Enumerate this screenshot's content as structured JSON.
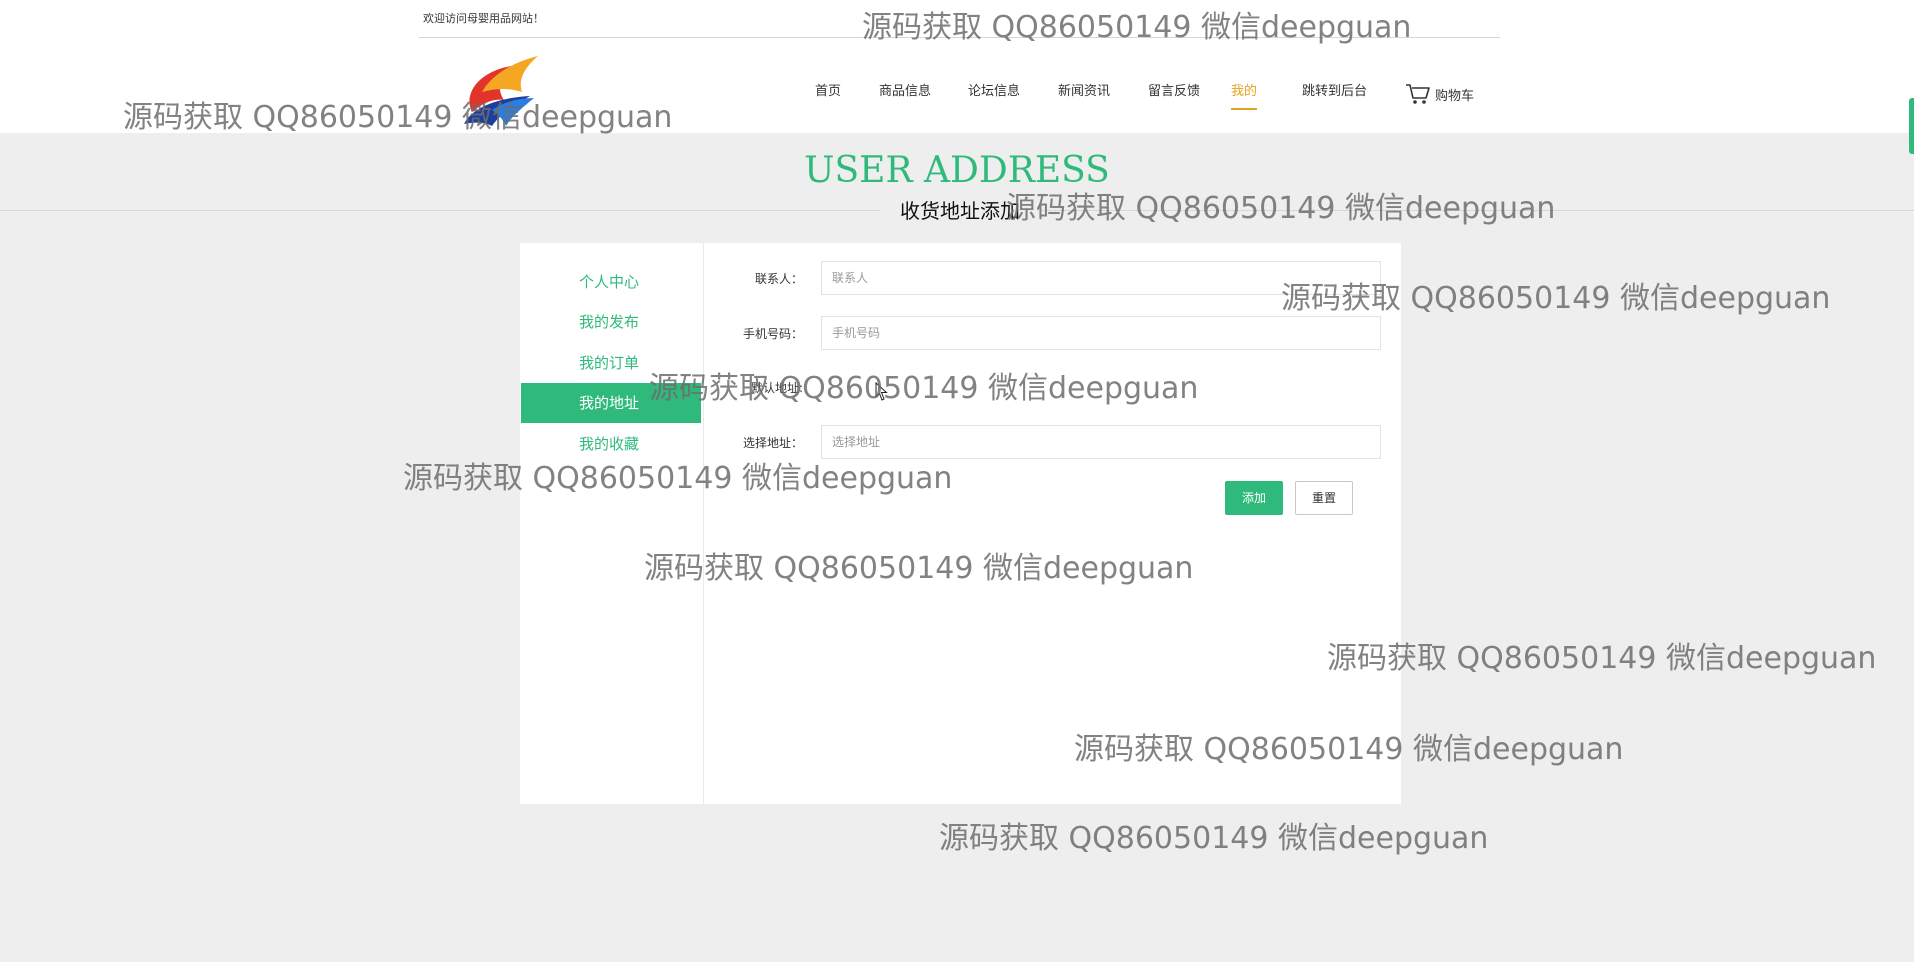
{
  "header": {
    "welcome": "欢迎访问母婴用品网站！",
    "nav": [
      {
        "label": "首页"
      },
      {
        "label": "商品信息"
      },
      {
        "label": "论坛信息"
      },
      {
        "label": "新闻资讯"
      },
      {
        "label": "留言反馈"
      },
      {
        "label": "我的",
        "active": true
      },
      {
        "label": "跳转到后台"
      }
    ],
    "cart_label": "购物车",
    "accent_color": "#e2a421"
  },
  "section": {
    "title": "USER ADDRESS",
    "subtitle": "收货地址添加",
    "brand_color": "#2fba7c"
  },
  "sidebar": {
    "items": [
      {
        "label": "个人中心"
      },
      {
        "label": "我的发布"
      },
      {
        "label": "我的订单"
      },
      {
        "label": "我的地址",
        "active": true
      },
      {
        "label": "我的收藏"
      }
    ]
  },
  "form": {
    "contact": {
      "label": "联系人：",
      "placeholder": "联系人"
    },
    "phone": {
      "label": "手机号码：",
      "placeholder": "手机号码"
    },
    "default_address": {
      "label": "默认地址:"
    },
    "address": {
      "label": "选择地址：",
      "placeholder": "选择地址"
    },
    "add_button": "添加",
    "reset_button": "重置"
  },
  "watermark": "源码获取 QQ86050149 微信deepguan"
}
